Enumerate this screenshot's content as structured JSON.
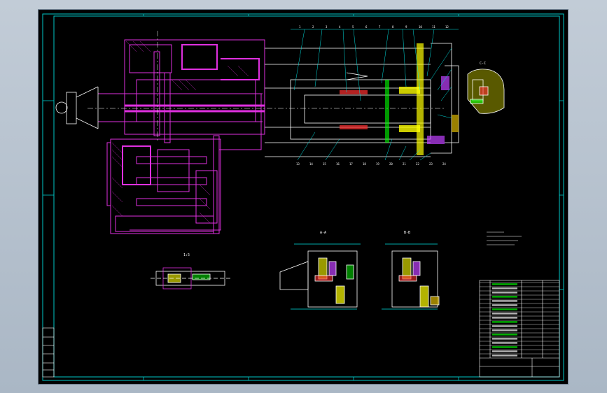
{
  "drawing": {
    "background": "#000000",
    "frame_color": "#00c8c8",
    "main_color": "#e030e0",
    "detail_color": "#ffffff",
    "leader_color": "#00e0e0",
    "section_labels": [
      "A-A",
      "B-B",
      "C-C",
      "1:5"
    ],
    "balloons": [
      "1",
      "2",
      "3",
      "4",
      "5",
      "6",
      "7",
      "8",
      "9",
      "10",
      "11",
      "12",
      "13",
      "14",
      "15",
      "16",
      "17",
      "18",
      "19",
      "20",
      "21",
      "22",
      "23",
      "24"
    ],
    "title_block_rows": 18
  }
}
